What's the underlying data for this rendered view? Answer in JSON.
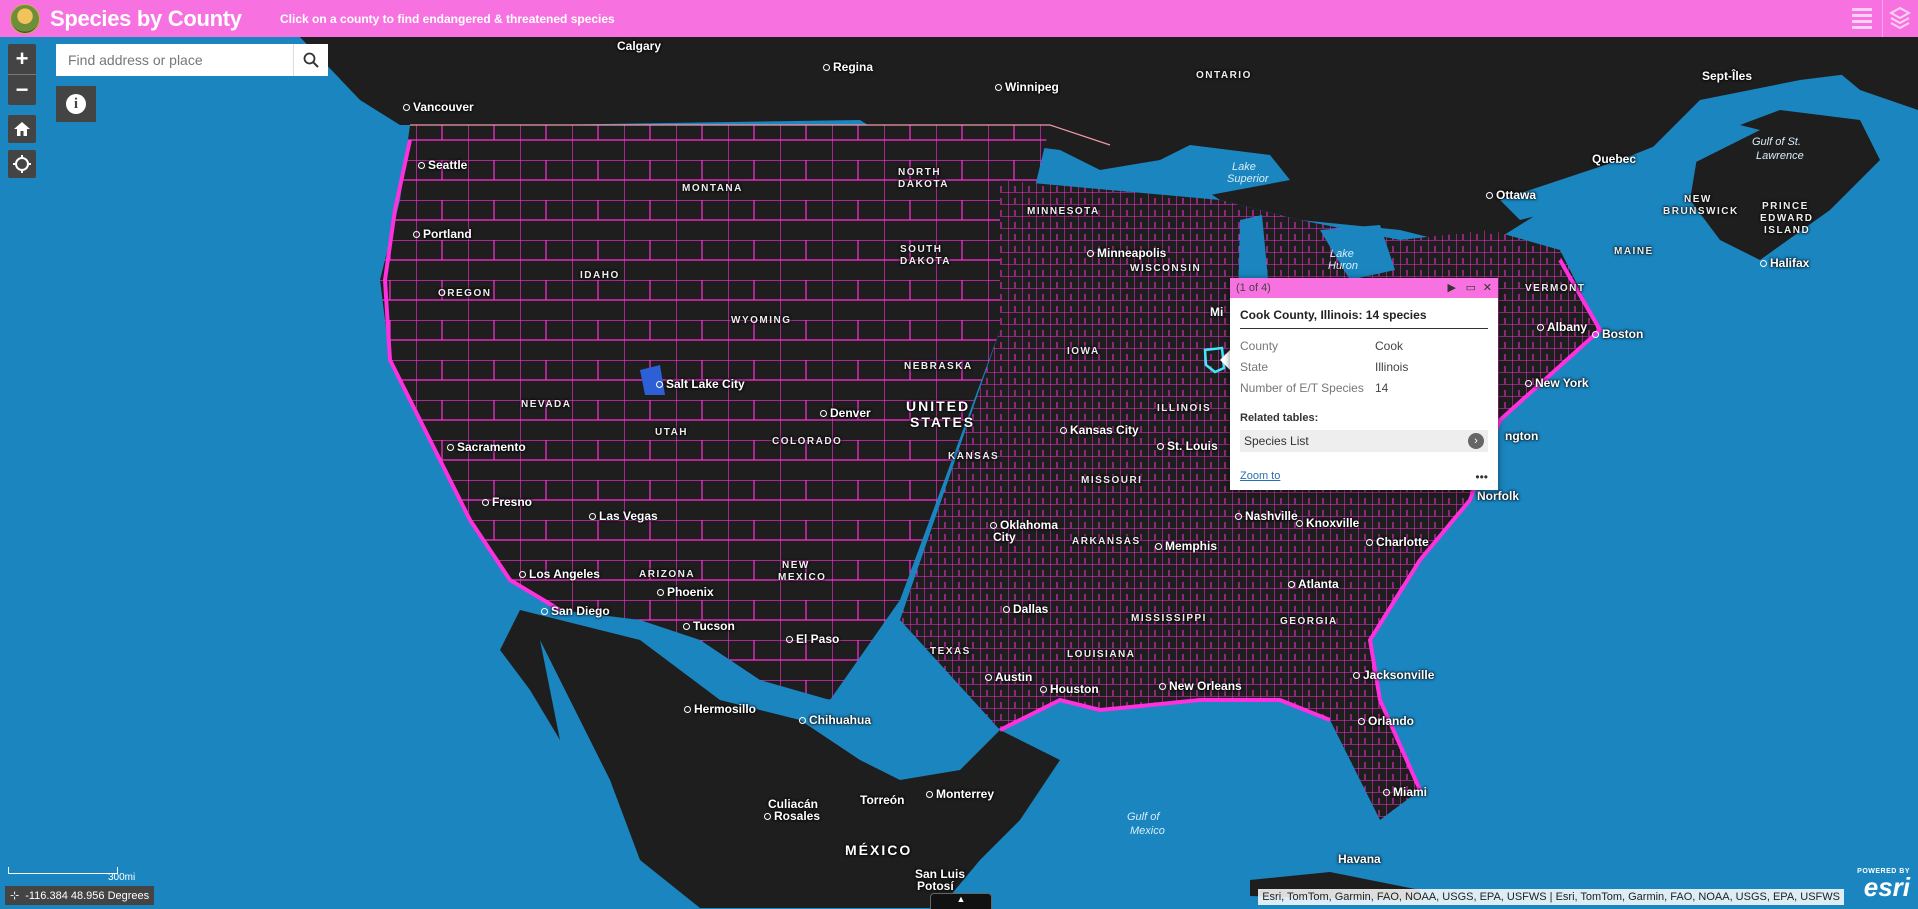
{
  "header": {
    "title": "Species by County",
    "subtitle": "Click on a county to find endangered & threatened species",
    "colors": {
      "header_bg": "#f772e0",
      "water": "#1a85bf",
      "land": "#1e1e1e",
      "county_line": "#ff3ce0"
    }
  },
  "search": {
    "placeholder": "Find address or place"
  },
  "zoom": {
    "in": "+",
    "out": "−"
  },
  "icons": [
    "home-icon",
    "locate-icon",
    "info-icon",
    "search-icon",
    "list-icon",
    "layers-icon"
  ],
  "popup": {
    "counter": "(1 of 4)",
    "title": "Cook County, Illinois: 14 species",
    "attributes": [
      {
        "key": "County",
        "value": "Cook"
      },
      {
        "key": "State",
        "value": "Illinois"
      },
      {
        "key": "Number of E/T Species",
        "value": "14"
      }
    ],
    "related_label": "Related tables:",
    "related_item": "Species List",
    "zoom_to": "Zoom to",
    "more": "•••"
  },
  "map_labels": {
    "countries": [
      "UNITED",
      "STATES",
      "MÉXICO"
    ],
    "states": [
      "MONTANA",
      "NORTH",
      "DAKOTA",
      "SOUTH",
      "DAKOTA",
      "MINNESOTA",
      "WISCONSIN",
      "OREGON",
      "IDAHO",
      "WYOMING",
      "NEBRASKA",
      "IOWA",
      "ILLINOIS",
      "NEVADA",
      "UTAH",
      "COLORADO",
      "KANSAS",
      "MISSOURI",
      "ARIZONA",
      "NEW",
      "MEXICO",
      "TEXAS",
      "ARKANSAS",
      "LOUISIANA",
      "MISSISSIPPI",
      "GEORGIA",
      "ONTARIO",
      "VERMONT",
      "MAINE",
      "NEW",
      "BRUNSWICK",
      "PRINCE",
      "EDWARD",
      "ISLAND"
    ],
    "cities": [
      "Calgary",
      "Regina",
      "Winnipeg",
      "Vancouver",
      "Seattle",
      "Portland",
      "Salt Lake City",
      "Sacramento",
      "Fresno",
      "Las Vegas",
      "Los Angeles",
      "San Diego",
      "Phoenix",
      "Tucson",
      "Denver",
      "El Paso",
      "Minneapolis",
      "Kansas City",
      "St. Louis",
      "Oklahoma",
      "City",
      "Dallas",
      "Austin",
      "Houston",
      "Memphis",
      "Nashville",
      "Knoxville",
      "Charlotte",
      "Atlanta",
      "New Orleans",
      "Jacksonville",
      "Orlando",
      "Miami",
      "Havana",
      "Hermosillo",
      "Chihuahua",
      "Culiacán",
      "Rosales",
      "Torreón",
      "Monterrey",
      "San Luis",
      "Potosí",
      "Ottawa",
      "Quebec",
      "Albany",
      "Boston",
      "New York",
      "Halifax",
      "Sept-Îles",
      "Norfolk",
      "Mi",
      "ngton"
    ],
    "water": [
      "Lake",
      "Superior",
      "Lake",
      "Huron",
      "Gulf of St.",
      "Lawrence",
      "Gulf of",
      "Mexico"
    ]
  },
  "scale": "300mi",
  "coordinates": "-116.384 48.956 Degrees",
  "attribution": "Esri, TomTom, Garmin, FAO, NOAA, USGS, EPA, USFWS | Esri, TomTom, Garmin, FAO, NOAA, USGS, EPA, USFWS",
  "esri": {
    "powered": "POWERED BY",
    "logo": "esri"
  }
}
